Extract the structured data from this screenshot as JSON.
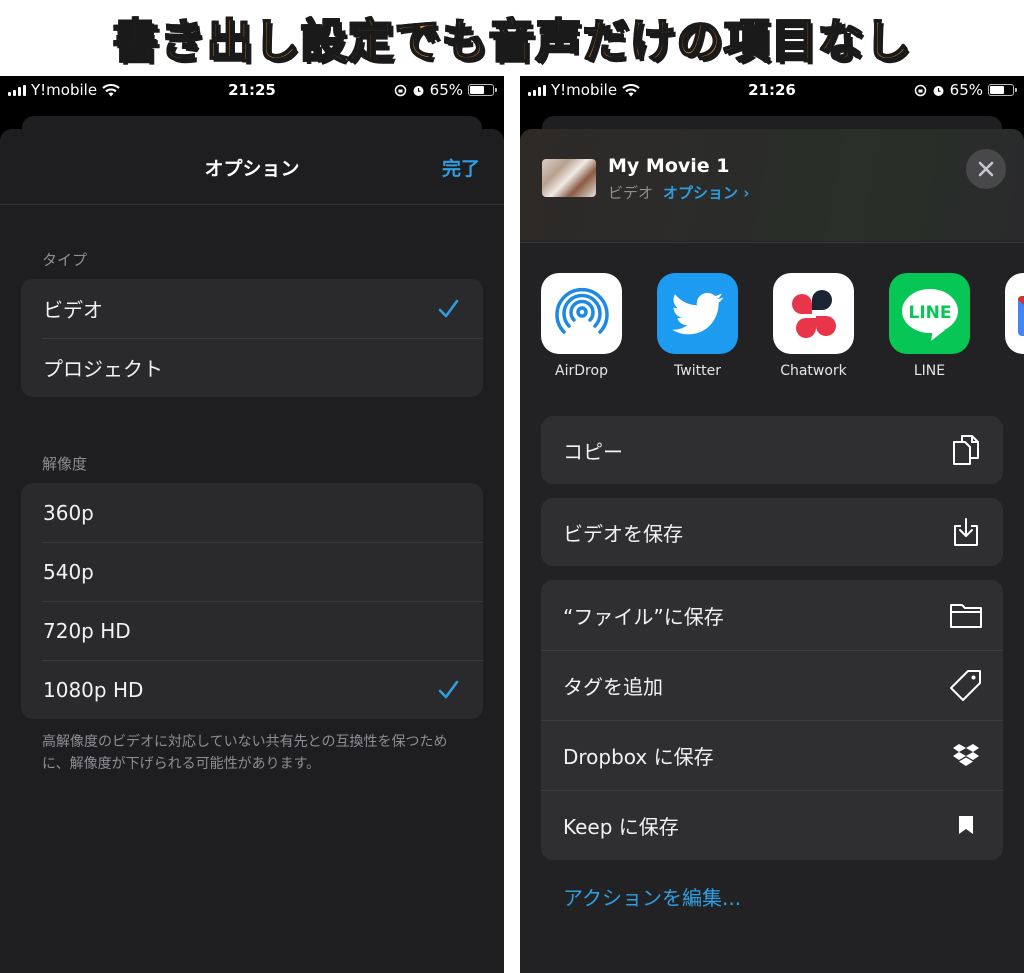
{
  "banner": {
    "title": "書き出し設定でも音声だけの項目なし"
  },
  "colors": {
    "accent": "#2f9ee0",
    "banner_fill": "#f7941d"
  },
  "left_screen": {
    "status_bar": {
      "carrier": "Y!mobile",
      "time": "21:25",
      "battery": "65%"
    },
    "nav": {
      "title": "オプション",
      "done": "完了"
    },
    "type_section": {
      "label": "タイプ",
      "items": [
        {
          "label": "ビデオ",
          "selected": true
        },
        {
          "label": "プロジェクト",
          "selected": false
        }
      ]
    },
    "resolution_section": {
      "label": "解像度",
      "items": [
        {
          "label": "360p",
          "selected": false
        },
        {
          "label": "540p",
          "selected": false
        },
        {
          "label": "720p HD",
          "selected": false
        },
        {
          "label": "1080p HD",
          "selected": true
        }
      ]
    },
    "footnote": "高解像度のビデオに対応していない共有先との互換性を保つために、解像度が下げられる可能性があります。"
  },
  "right_screen": {
    "status_bar": {
      "carrier": "Y!mobile",
      "time": "21:26",
      "battery": "65%"
    },
    "share_header": {
      "title": "My Movie 1",
      "type": "ビデオ",
      "options_link": "オプション ›"
    },
    "apps": [
      {
        "label": "AirDrop",
        "icon": "airdrop-icon"
      },
      {
        "label": "Twitter",
        "icon": "twitter-icon"
      },
      {
        "label": "Chatwork",
        "icon": "chatwork-icon"
      },
      {
        "label": "LINE",
        "icon": "line-icon"
      }
    ],
    "actions_group1": [
      {
        "label": "コピー",
        "icon": "copy-icon"
      }
    ],
    "actions_group2": [
      {
        "label": "ビデオを保存",
        "icon": "save-download-icon"
      }
    ],
    "actions_group3": [
      {
        "label": "“ファイル”に保存",
        "icon": "folder-icon"
      },
      {
        "label": "タグを追加",
        "icon": "tag-icon"
      },
      {
        "label": "Dropbox に保存",
        "icon": "dropbox-icon"
      },
      {
        "label": "Keep に保存",
        "icon": "bookmark-icon"
      }
    ],
    "edit_actions": "アクションを編集..."
  }
}
